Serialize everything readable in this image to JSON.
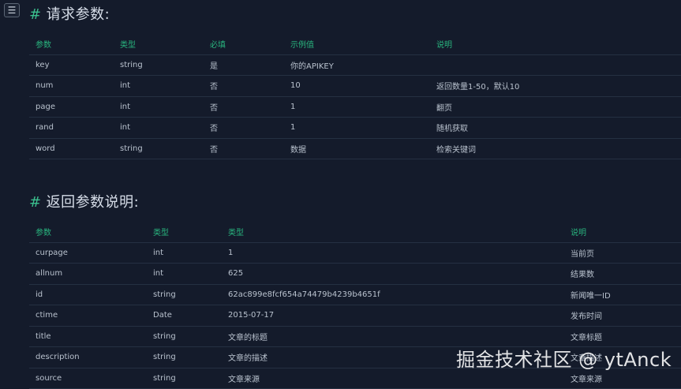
{
  "toc_icon": "list-icon",
  "request": {
    "title": "请求参数:",
    "headers": [
      "参数",
      "类型",
      "必填",
      "示例值",
      "说明"
    ],
    "rows": [
      [
        "key",
        "string",
        "是",
        "你的APIKEY",
        ""
      ],
      [
        "num",
        "int",
        "否",
        "10",
        "返回数量1-50，默认10"
      ],
      [
        "page",
        "int",
        "否",
        "1",
        "翻页"
      ],
      [
        "rand",
        "int",
        "否",
        "1",
        "随机获取"
      ],
      [
        "word",
        "string",
        "否",
        "数据",
        "检索关键词"
      ]
    ]
  },
  "response": {
    "title": "返回参数说明:",
    "headers": [
      "参数",
      "类型",
      "类型",
      "说明"
    ],
    "rows": [
      [
        "curpage",
        "int",
        "1",
        "当前页"
      ],
      [
        "allnum",
        "int",
        "625",
        "结果数"
      ],
      [
        "id",
        "string",
        "62ac899e8fcf654a74479b4239b4651f",
        "新闻唯一ID"
      ],
      [
        "ctime",
        "Date",
        "2015-07-17",
        "发布时间"
      ],
      [
        "title",
        "string",
        "文章的标题",
        "文章标题"
      ],
      [
        "description",
        "string",
        "文章的描述",
        "文章描述"
      ],
      [
        "source",
        "string",
        "文章来源",
        "文章来源"
      ]
    ]
  },
  "watermark": "掘金技术社区 @ ytAnck",
  "hash_symbol": "#"
}
